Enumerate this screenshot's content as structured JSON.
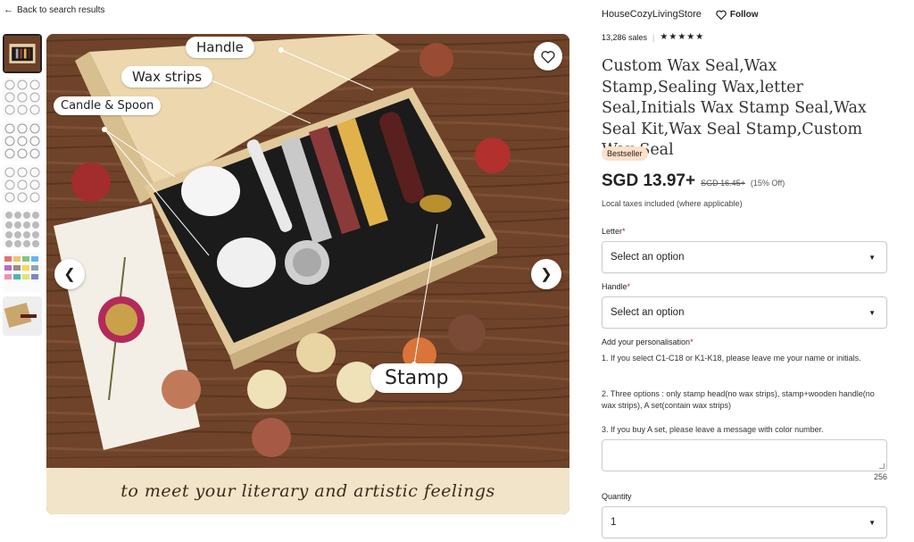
{
  "nav": {
    "back_label": "Back to search results"
  },
  "image": {
    "callouts": {
      "handle": "Handle",
      "wax_strips": "Wax strips",
      "candle_spoon": "Candle & Spoon",
      "stamp": "Stamp"
    },
    "caption": "to meet your literary and artistic feelings"
  },
  "shop": {
    "name": "HouseCozyLivingStore",
    "follow_label": "Follow",
    "sales": "13,286 sales",
    "rating_stars": "★★★★★"
  },
  "product": {
    "title": "Custom Wax Seal,Wax Stamp,Sealing Wax,letter Seal,Initials Wax Stamp Seal,Wax Seal Kit,Wax Seal Stamp,Custom Wax Seal",
    "badge": "Bestseller",
    "price": "SGD 13.97+",
    "old_price": "SGD 16.45+",
    "discount": "(15% Off)",
    "tax_note": "Local taxes included (where applicable)"
  },
  "options": {
    "letter_label": "Letter",
    "letter_value": "Select an option",
    "handle_label": "Handle",
    "handle_value": "Select an option",
    "personalisation_label": "Add your personalisation",
    "instructions": [
      "1. If you select C1-C18 or K1-K18, please leave me your name or initials.",
      "2. Three options : only stamp head(no wax strips), stamp+wooden handle(no wax strips), A set(contain wax strips)",
      "3. If you buy A set, please leave a message with color number."
    ],
    "char_count": "256",
    "quantity_label": "Quantity",
    "quantity_value": "1",
    "required_mark": "*"
  },
  "colors": {
    "accent_red": "#b3261e",
    "badge_bg": "#fde0c8",
    "wood": "#6b4228",
    "box": "#e6cfa4"
  }
}
